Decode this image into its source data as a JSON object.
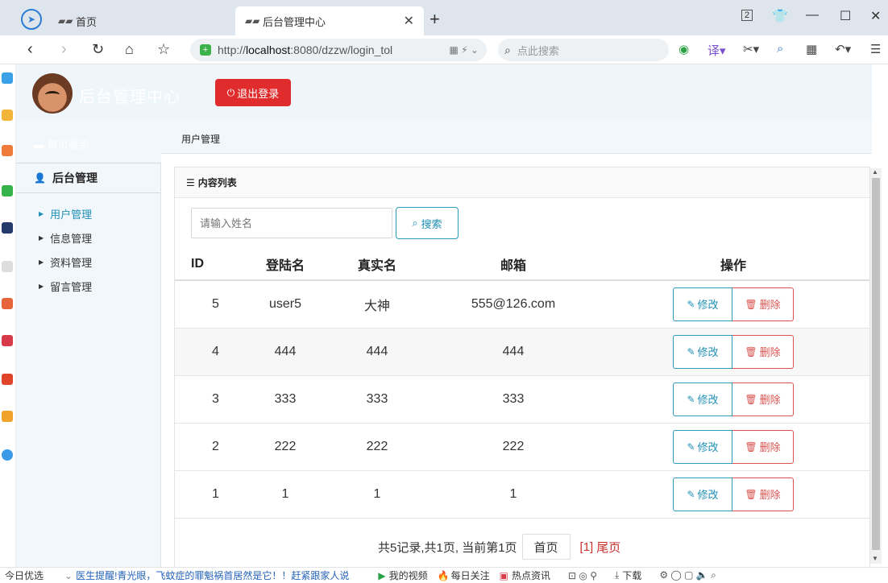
{
  "browser": {
    "tabs": [
      {
        "label": "首页",
        "active": false
      },
      {
        "label": "后台管理中心",
        "active": true
      }
    ],
    "url_prefix": "http://",
    "url_host": "localhost",
    "url_rest": ":8080/dzzw/login_tol",
    "search_placeholder": "点此搜索",
    "tab_count": "2"
  },
  "header": {
    "site_title": "后台管理中心",
    "logout_label": "退出登录",
    "dashboard_link": "首页展示"
  },
  "breadcrumb": "用户管理",
  "sidebar": {
    "heading": "后台管理",
    "items": [
      {
        "label": "用户管理",
        "active": true
      },
      {
        "label": "信息管理",
        "active": false
      },
      {
        "label": "资料管理",
        "active": false
      },
      {
        "label": "留言管理",
        "active": false
      }
    ]
  },
  "panel": {
    "title": "内容列表",
    "search_placeholder": "请输入姓名",
    "search_button": "搜索"
  },
  "table": {
    "headers": [
      "ID",
      "登陆名",
      "真实名",
      "邮箱",
      "操作"
    ],
    "rows": [
      {
        "id": "5",
        "login": "user5",
        "name": "大神",
        "email": "555@126.com"
      },
      {
        "id": "4",
        "login": "444",
        "name": "444",
        "email": "444"
      },
      {
        "id": "3",
        "login": "333",
        "name": "333",
        "email": "333"
      },
      {
        "id": "2",
        "login": "222",
        "name": "222",
        "email": "222"
      },
      {
        "id": "1",
        "login": "1",
        "name": "1",
        "email": "1"
      }
    ],
    "edit_label": "修改",
    "delete_label": "删除"
  },
  "pager": {
    "summary": "共5记录,共1页, 当前第1页",
    "first": "首页",
    "current": "[1]",
    "last": "尾页"
  },
  "statusbar": {
    "today": "今日优选",
    "news": "医生提醒!青光眼，飞蚊症的罪魁祸首居然是它！！赶紧跟家人说",
    "video": "我的视频",
    "follow": "每日关注",
    "hot": "热点资讯",
    "download": "下载"
  },
  "colors": {
    "logout_bg": "#e02c2c",
    "primary": "#1f8fb5",
    "danger": "#d9534f"
  }
}
